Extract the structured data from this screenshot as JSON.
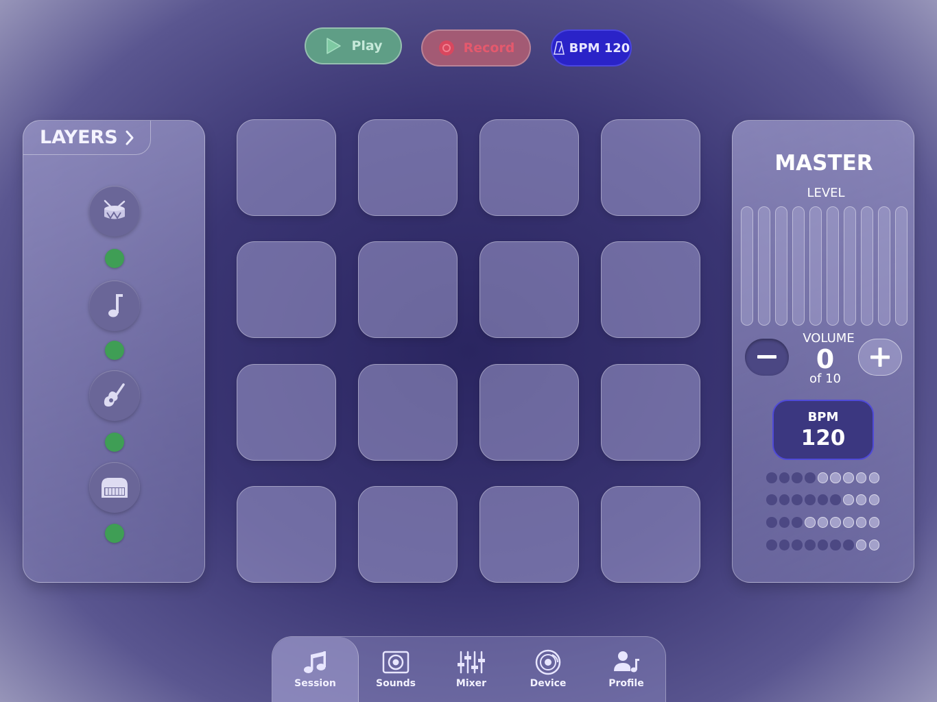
{
  "toolbar": {
    "play_label": "Play",
    "record_label": "Record",
    "bpm_label": "BPM 120"
  },
  "layers": {
    "title": "LAYERS",
    "items": [
      {
        "icon": "drum-icon",
        "active": true
      },
      {
        "icon": "music-note-icon",
        "active": true
      },
      {
        "icon": "guitar-icon",
        "active": true
      },
      {
        "icon": "piano-icon",
        "active": true
      }
    ]
  },
  "pads": {
    "rows": 4,
    "columns": 4
  },
  "master": {
    "title": "MASTER",
    "level_label": "LEVEL",
    "level_meter_count": 10,
    "volume_label": "VOLUME",
    "volume_value": "0",
    "volume_of": "of 10",
    "bpm_label": "BPM",
    "bpm_value": "120",
    "step_rows": [
      4,
      6,
      3,
      7
    ],
    "steps_per_row": 9
  },
  "tabs": [
    {
      "label": "Session",
      "icon": "music-notes-icon",
      "active": true
    },
    {
      "label": "Sounds",
      "icon": "speaker-icon",
      "active": false
    },
    {
      "label": "Mixer",
      "icon": "mixer-sliders-icon",
      "active": false
    },
    {
      "label": "Device",
      "icon": "record-disc-icon",
      "active": false
    },
    {
      "label": "Profile",
      "icon": "user-music-icon",
      "active": false
    }
  ],
  "colors": {
    "play": "#5f9e86",
    "record": "#a35a74",
    "record_text": "#e4596d",
    "bpm_accent": "#2a23c8",
    "layer_active": "#3f9e55"
  }
}
